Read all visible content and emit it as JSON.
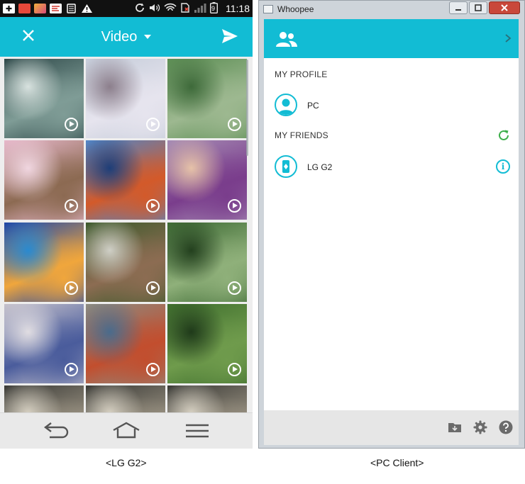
{
  "phone": {
    "status_bar": {
      "time": "11:18",
      "battery_level": "9"
    },
    "app_bar": {
      "title": "Video"
    },
    "thumbnails": [
      {
        "subject": "pufferfish",
        "colors": [
          "#2f4a4a",
          "#7f9c96",
          "#d8e2df"
        ]
      },
      {
        "subject": "cherry-blossoms",
        "colors": [
          "#c6cdda",
          "#e6e4ee",
          "#8c7f8c"
        ]
      },
      {
        "subject": "rice-terraces",
        "colors": [
          "#5c8e54",
          "#9db890",
          "#3e6a3a"
        ]
      },
      {
        "subject": "kitten-and-deer",
        "colors": [
          "#e7b8cb",
          "#8c6a52",
          "#f0d6e0"
        ]
      },
      {
        "subject": "hot-air-balloons",
        "colors": [
          "#4f86c9",
          "#d35a2a",
          "#1e3e78"
        ]
      },
      {
        "subject": "flower-field-sunset",
        "colors": [
          "#a68cb4",
          "#7a3d8c",
          "#e6c2a8"
        ]
      },
      {
        "subject": "aquarium-fish",
        "colors": [
          "#1e46a8",
          "#f0a63c",
          "#2a8ad0"
        ]
      },
      {
        "subject": "stone-wall-lane",
        "colors": [
          "#3c5a2c",
          "#8c6c52",
          "#cfcfc6"
        ]
      },
      {
        "subject": "bamboo-forest",
        "colors": [
          "#3d6a34",
          "#8fb07a",
          "#23401e"
        ]
      },
      {
        "subject": "porcelain-vases",
        "colors": [
          "#c6c2cc",
          "#4a5c9c",
          "#e0dde2"
        ]
      },
      {
        "subject": "crowded-pier",
        "colors": [
          "#8c8c82",
          "#c24e2e",
          "#4a6b8c"
        ]
      },
      {
        "subject": "green-forest",
        "colors": [
          "#3f6e2e",
          "#6f9b4c",
          "#1f3a1a"
        ]
      },
      {
        "subject": "partial-row-1",
        "colors": [
          "#3a3a36",
          "#9c9484",
          "#d6d0c2"
        ]
      },
      {
        "subject": "partial-row-2",
        "colors": [
          "#3a3a36",
          "#9c9484",
          "#d6d0c2"
        ]
      },
      {
        "subject": "partial-row-3",
        "colors": [
          "#3a3a36",
          "#9c9484",
          "#d6d0c2"
        ]
      }
    ],
    "nav": [
      "back-icon",
      "home-icon",
      "menu-icon"
    ]
  },
  "pc_client": {
    "window_title": "Whoopee",
    "sections": {
      "my_profile": "MY PROFILE",
      "profile_name": "PC",
      "my_friends": "MY FRIENDS",
      "friend_name": "LG G2"
    },
    "info_glyph": "i",
    "footer_icons": [
      "download-folder-icon",
      "settings-gear-icon",
      "help-icon"
    ]
  },
  "captions": {
    "left": "<LG G2>",
    "right": "<PC Client>"
  },
  "colors": {
    "accent": "#12bcd4",
    "refresh": "#3cae4a",
    "status_bar": "#111111"
  }
}
